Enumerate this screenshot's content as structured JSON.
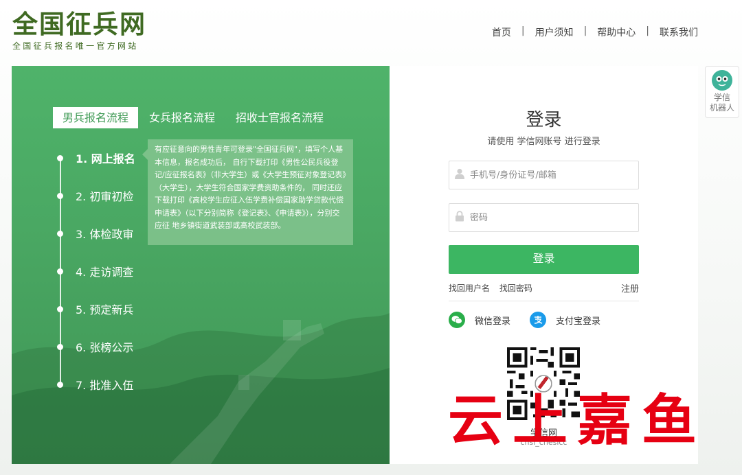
{
  "header": {
    "logo_title": "全国征兵网",
    "logo_subtitle": "全国征兵报名唯一官方网站",
    "nav": [
      "首页",
      "用户须知",
      "帮助中心",
      "联系我们"
    ],
    "nav_separator": "|"
  },
  "process": {
    "tabs": [
      {
        "label": "男兵报名流程",
        "active": true
      },
      {
        "label": "女兵报名流程",
        "active": false
      },
      {
        "label": "招收士官报名流程",
        "active": false
      }
    ],
    "steps": [
      {
        "label": "1. 网上报名",
        "active": true
      },
      {
        "label": "2. 初审初检",
        "active": false
      },
      {
        "label": "3. 体检政审",
        "active": false
      },
      {
        "label": "4. 走访调查",
        "active": false
      },
      {
        "label": "5. 预定新兵",
        "active": false
      },
      {
        "label": "6. 张榜公示",
        "active": false
      },
      {
        "label": "7. 批准入伍",
        "active": false
      }
    ],
    "tooltip": "有应征意向的男性青年可登录\"全国征兵网\"，填写个人基本信息，报名成功后， 自行下载打印《男性公民兵役登记/应征报名表》（非大学生）或《大学生预征对象登记表》（大学生），大学生符合国家学费资助条件的， 同时还应下载打印《高校学生应征入伍学费补偿国家助学贷款代偿申请表》（以下分别简称《登记表》、《申请表》），分别交应征 地乡镇街道武装部或高校武装部。"
  },
  "login": {
    "title": "登录",
    "subtitle": "请使用  学信网账号  进行登录",
    "username_placeholder": "手机号/身份证号/邮箱",
    "password_placeholder": "密码",
    "submit_label": "登录",
    "forgot_username": "找回用户名",
    "forgot_password": "找回密码",
    "register": "注册",
    "wechat_label": "微信登录",
    "alipay_label": "支付宝登录",
    "qr_name": "学信网",
    "qr_id": "chsi_chesicc"
  },
  "robot": {
    "label_line1": "学信",
    "label_line2": "机器人"
  },
  "watermark": "云上嘉鱼",
  "colors": {
    "brand_green": "#3f6a22",
    "panel_green": "#4aa863",
    "button_green": "#3cb662",
    "wechat": "#2aae4a",
    "alipay": "#1a9bea",
    "watermark_red": "#e60012"
  },
  "icons": {
    "username": "user-icon",
    "password": "lock-icon",
    "wechat": "wechat-icon",
    "alipay": "alipay-icon",
    "robot": "robot-icon"
  }
}
